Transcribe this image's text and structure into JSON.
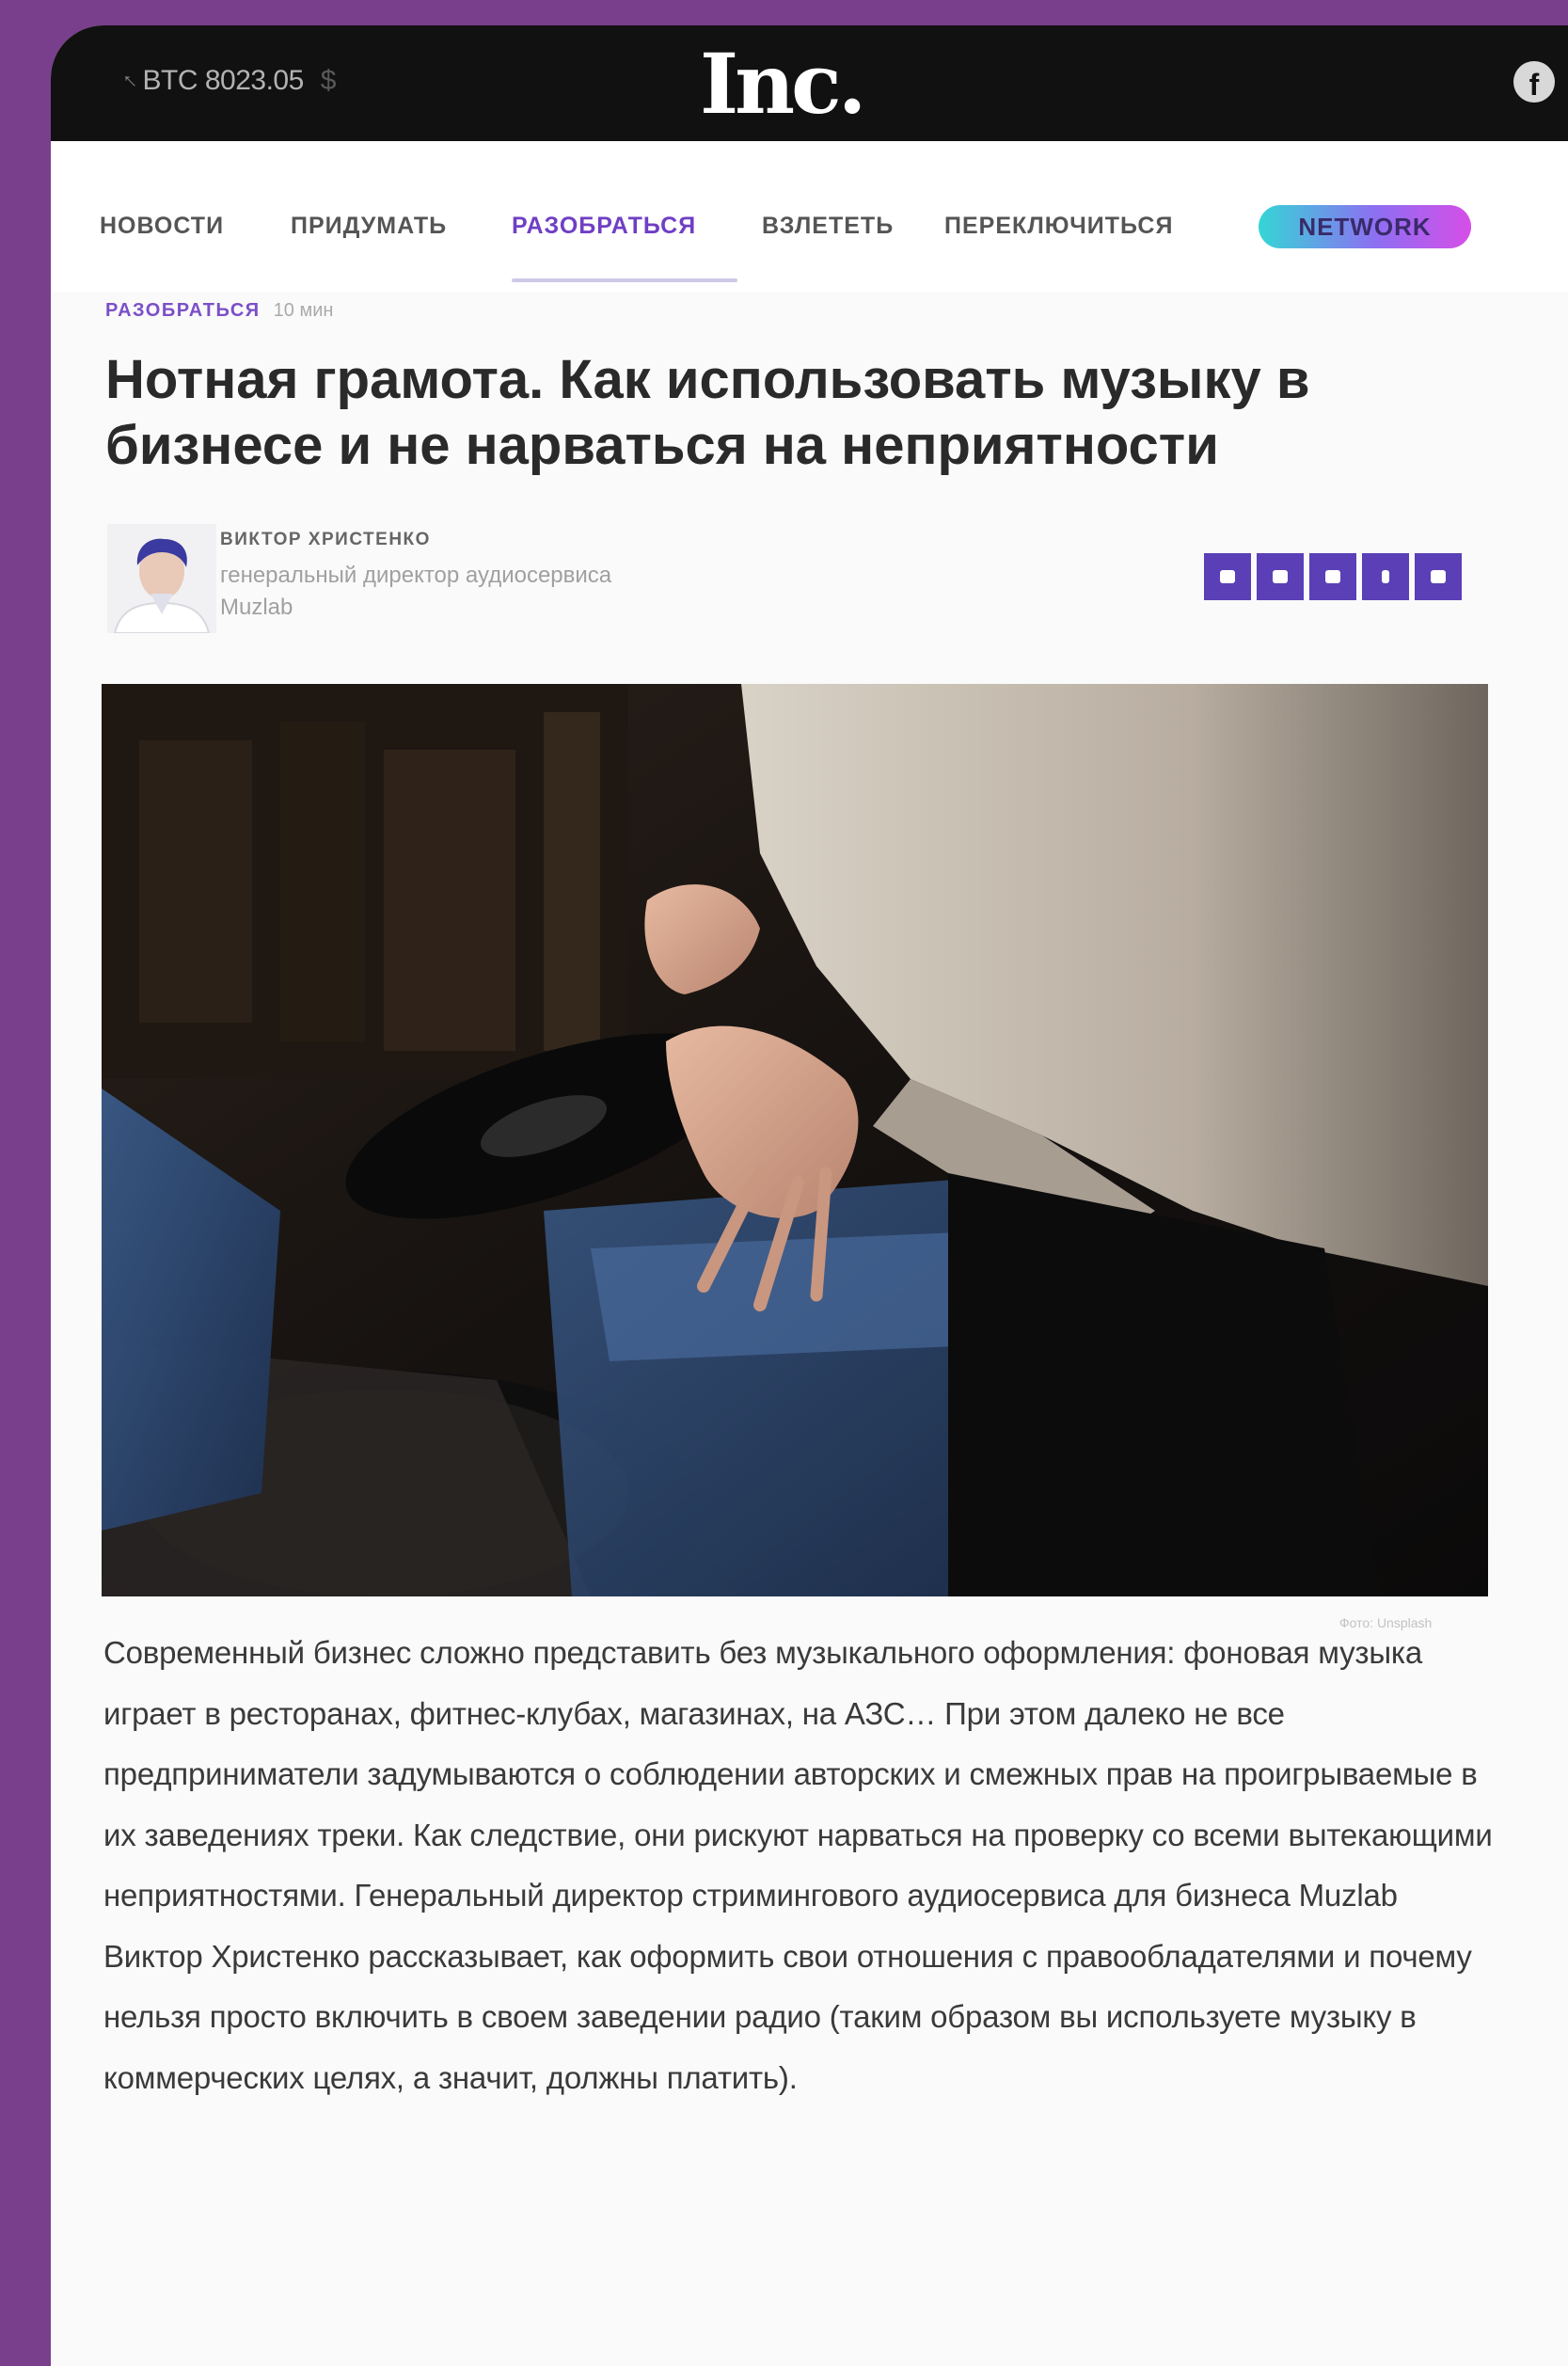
{
  "topbar": {
    "ticker": "BTC 8023.05",
    "ticker_suffix": "$",
    "logo": "Inc.",
    "social_icon": "facebook-icon"
  },
  "nav": {
    "items": [
      {
        "label": "НОВОСТИ",
        "active": false
      },
      {
        "label": "ПРИДУМАТЬ",
        "active": false
      },
      {
        "label": "РАЗОБРАТЬСЯ",
        "active": true
      },
      {
        "label": "ВЗЛЕТЕТЬ",
        "active": false
      },
      {
        "label": "ПЕРЕКЛЮЧИТЬСЯ",
        "active": false
      }
    ],
    "network_label": "NETWORK"
  },
  "article": {
    "category": "РАЗОБРАТЬСЯ",
    "read_time": "10 мин",
    "headline": "Нотная грамота. Как использовать музыку в бизнесе и не нарваться на неприятности",
    "author": {
      "name": "ВИКТОР ХРИСТЕНКО",
      "role": "генеральный директор аудиосервиса Muzlab"
    },
    "share_buttons": [
      "twitter-icon",
      "vk-icon",
      "telegram-icon",
      "mail-icon",
      "facebook-icon"
    ],
    "photo_credit": "Фото: Unsplash",
    "lead": "Современный бизнес сложно представить без музыкального оформления: фоновая музыка играет в ресторанах, фитнес-клубах, магазинах, на АЗС… При этом далеко не все предприниматели задумываются о соблюдении авторских и смежных прав на проигрываемые в их заведениях треки. Как следствие, они рискуют нарваться на проверку со всеми вытекающими неприятностями. Генеральный директор стримингового аудиосервиса для бизнеса Muzlab Виктор Христенко рассказывает, как оформить свои отношения с правообладателями и почему нельзя просто включить в своем заведении радио (таким образом вы используете музыку в коммерческих целях, а значит, должны платить)."
  },
  "colors": {
    "frame": "#7a3f8c",
    "accent": "#6f3fc4",
    "share": "#5a3fb6"
  }
}
